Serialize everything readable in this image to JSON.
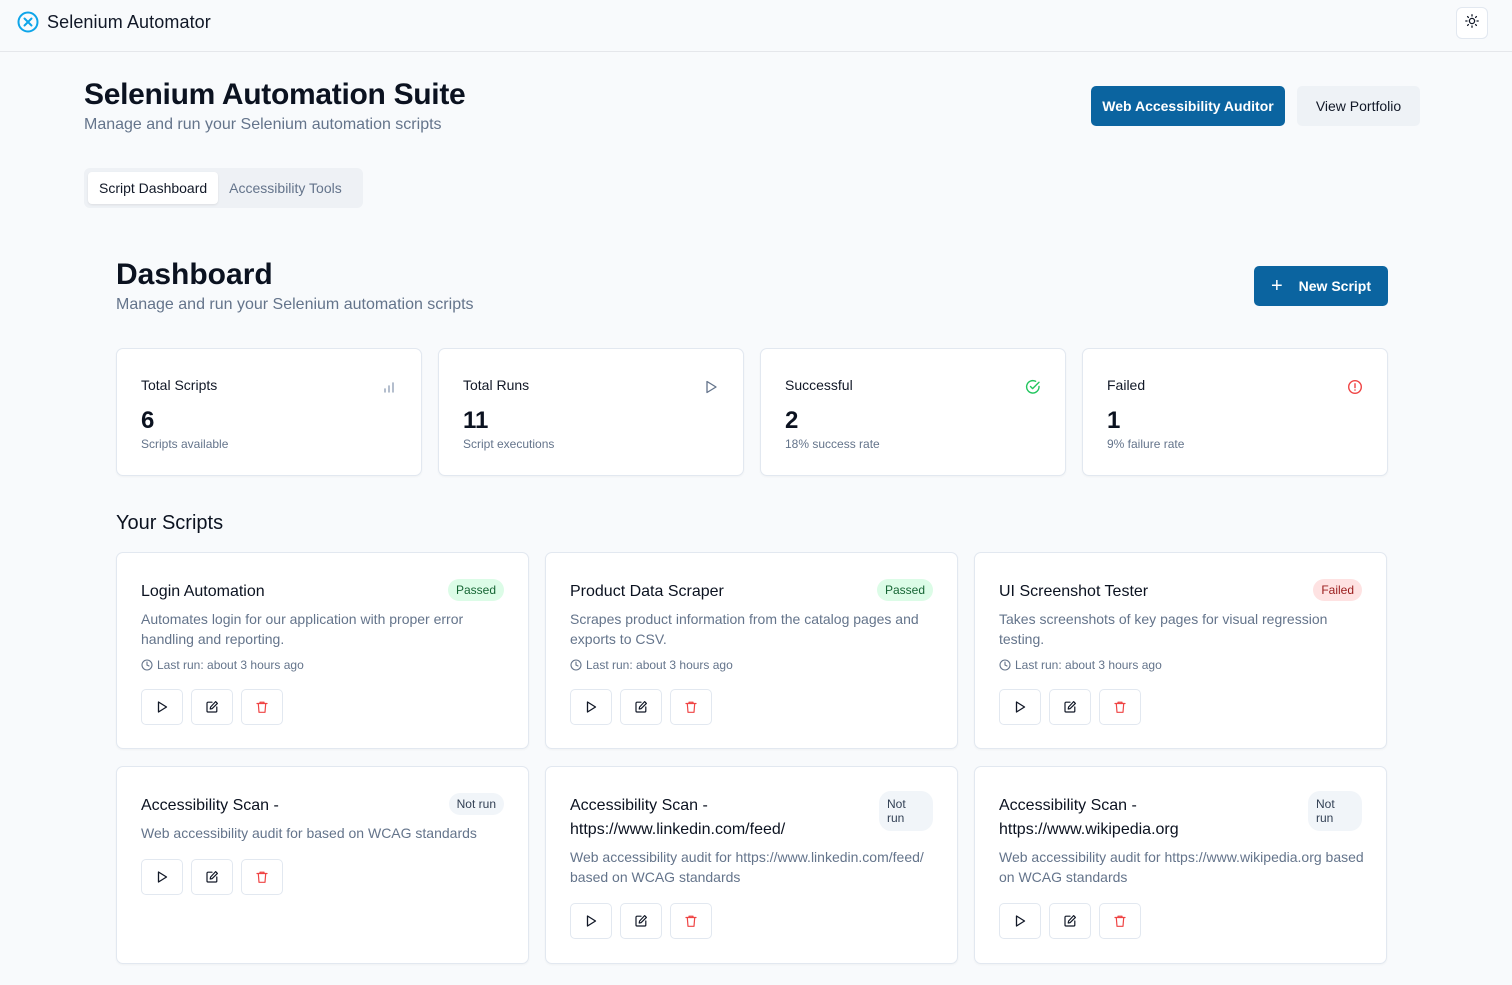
{
  "app": {
    "title": "Selenium Automator"
  },
  "header": {
    "title": "Selenium Automation Suite",
    "subtitle": "Manage and run your Selenium automation scripts",
    "auditor_button": "Web Accessibility Auditor",
    "portfolio_button": "View Portfolio"
  },
  "tabs": [
    {
      "label": "Script Dashboard",
      "active": true
    },
    {
      "label": "Accessibility Tools",
      "active": false
    }
  ],
  "dashboard": {
    "title": "Dashboard",
    "subtitle": "Manage and run your Selenium automation scripts",
    "new_button": "New Script"
  },
  "stats": [
    {
      "label": "Total Scripts",
      "value": "6",
      "note": "Scripts available",
      "icon": "bar-chart-icon",
      "color": "#94a3b8"
    },
    {
      "label": "Total Runs",
      "value": "11",
      "note": "Script executions",
      "icon": "play-icon",
      "color": "#64748b"
    },
    {
      "label": "Successful",
      "value": "2",
      "note": "18% success rate",
      "icon": "check-circle-icon",
      "color": "#22c55e"
    },
    {
      "label": "Failed",
      "value": "1",
      "note": "9% failure rate",
      "icon": "alert-circle-icon",
      "color": "#ef4444"
    }
  ],
  "scripts_section": {
    "title": "Your Scripts"
  },
  "scripts": [
    {
      "name": "Login Automation",
      "status": "Passed",
      "description": "Automates login for our application with proper error handling and reporting.",
      "last_run": "Last run: about 3 hours ago"
    },
    {
      "name": "Product Data Scraper",
      "status": "Passed",
      "description": "Scrapes product information from the catalog pages and exports to CSV.",
      "last_run": "Last run: about 3 hours ago"
    },
    {
      "name": "UI Screenshot Tester",
      "status": "Failed",
      "description": "Takes screenshots of key pages for visual regression testing.",
      "last_run": "Last run: about 3 hours ago"
    },
    {
      "name": "Accessibility Scan -",
      "status": "Not run",
      "description": "Web accessibility audit for based on WCAG standards",
      "last_run": ""
    },
    {
      "name": "Accessibility Scan - https://www.linkedin.com/feed/",
      "status": "Not run",
      "description": "Web accessibility audit for https://www.linkedin.com/feed/ based on WCAG standards",
      "last_run": ""
    },
    {
      "name": "Accessibility Scan - https://www.wikipedia.org",
      "status": "Not run",
      "description": "Web accessibility audit for https://www.wikipedia.org based on WCAG standards",
      "last_run": ""
    }
  ],
  "colors": {
    "primary": "#0b64a0",
    "danger": "#ef4444",
    "success": "#22c55e",
    "brand_icon": "#0ea5e9"
  }
}
